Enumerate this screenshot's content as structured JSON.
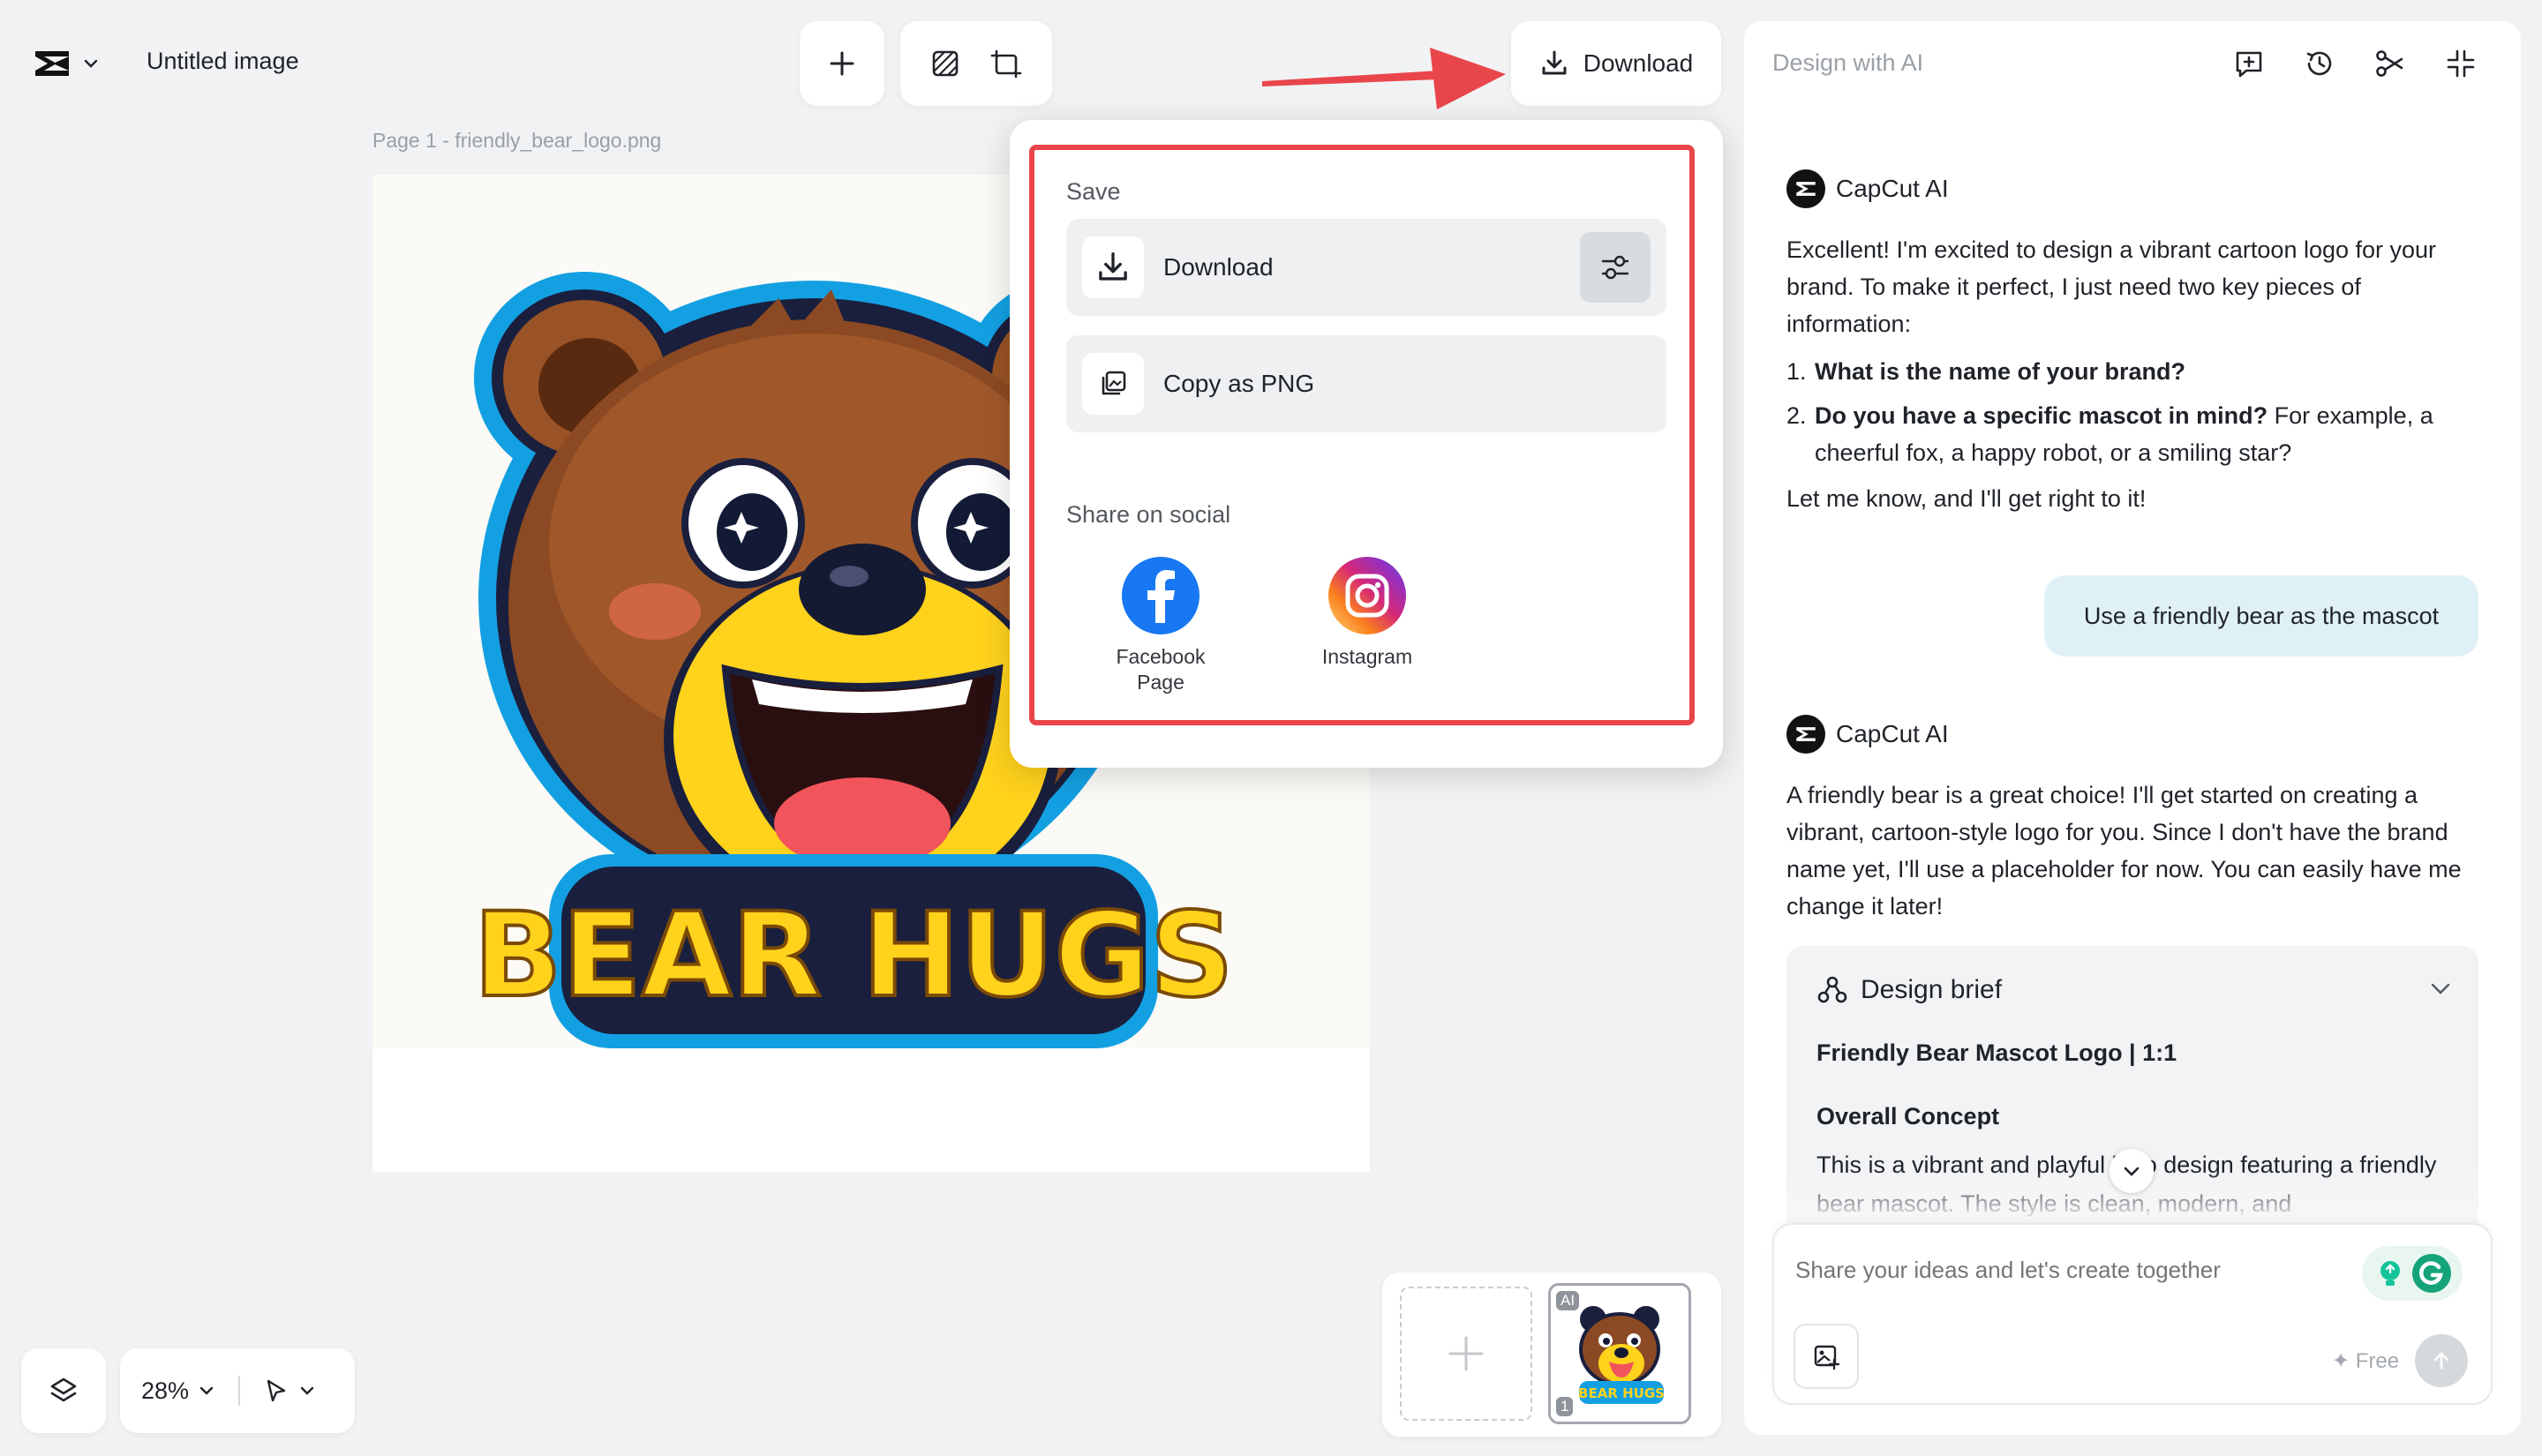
{
  "app": {
    "title": "Untitled image",
    "page_label": "Page 1 -  friendly_bear_logo.png",
    "download_label": "Download"
  },
  "canvas": {
    "logo_text": "BEAR HUGS"
  },
  "popup": {
    "save_label": "Save",
    "download_label": "Download",
    "copy_label": "Copy as PNG",
    "share_label": "Share on social",
    "facebook_line1": "Facebook",
    "facebook_line2": "Page",
    "instagram_label": "Instagram"
  },
  "bottom": {
    "zoom": "28%",
    "thumb_ai_badge": "AI",
    "thumb_page_badge": "1",
    "thumb_text": "BEAR HUGS"
  },
  "panel": {
    "title": "Design with AI",
    "ai_name": "CapCut AI",
    "msg1_intro": "Excellent! I'm excited to design a vibrant cartoon logo for your brand. To make it perfect, I just need two key pieces of information:",
    "msg1_q1_num": "1.",
    "msg1_q1": "What is the name of your brand?",
    "msg1_q2_num": "2.",
    "msg1_q2_bold": "Do you have a specific mascot in mind?",
    "msg1_q2_rest": " For example, a cheerful fox, a happy robot, or a smiling star?",
    "msg1_outro": "Let me know, and I'll get right to it!",
    "user_msg": "Use a friendly bear as the mascot",
    "msg2": "A friendly bear is a great choice! I'll get started on creating a vibrant, cartoon-style logo for you. Since I don't have the brand name yet, I'll use a placeholder for now. You can easily have me change it later!",
    "brief_title": "Design brief",
    "brief_subtitle": "Friendly Bear Mascot Logo | 1:1",
    "brief_concept_label": "Overall Concept",
    "brief_concept_text": "This is a vibrant and playful logo design featuring a friendly bear mascot. The style is clean, modern, and",
    "input_placeholder": "Share your ideas and let's create together",
    "free_label": "Free"
  },
  "colors": {
    "accent_red": "#e8464b",
    "facebook_blue": "#1877f2",
    "bear_brown": "#8b4a23",
    "logo_yellow": "#ffd21c",
    "logo_blue": "#19a7e8"
  }
}
